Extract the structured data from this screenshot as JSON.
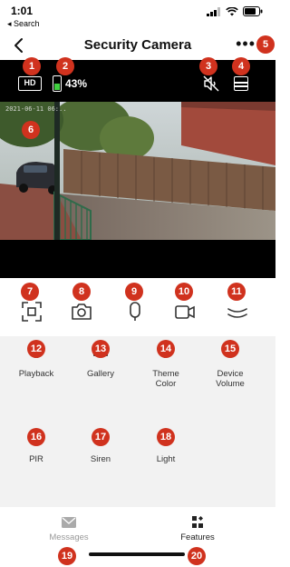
{
  "status_bar": {
    "time": "1:01",
    "back_label": "◂ Search",
    "icons": [
      "signal-icon",
      "wifi-icon",
      "battery-icon"
    ]
  },
  "nav": {
    "title": "Security Camera",
    "back_icon": "chevron-left-icon",
    "more_icon": "more-horizontal-icon",
    "more_glyph": "•••"
  },
  "video": {
    "quality": "HD",
    "battery_percent": "43%",
    "battery_level": 0.43,
    "timestamp": "2021-06-11 06:..",
    "mute_icon": "speaker-muted-icon",
    "layout_icon": "layout-icon"
  },
  "controls": [
    {
      "name": "fullscreen",
      "icon": "fullscreen-icon"
    },
    {
      "name": "snapshot",
      "icon": "camera-icon"
    },
    {
      "name": "talk",
      "icon": "microphone-icon"
    },
    {
      "name": "record",
      "icon": "video-record-icon"
    },
    {
      "name": "collapse",
      "icon": "chevron-double-down-icon"
    }
  ],
  "features": [
    {
      "label": "Playback",
      "icon": "play-circle-icon"
    },
    {
      "label": "Gallery",
      "icon": "image-icon"
    },
    {
      "label": "Theme\nColor",
      "icon": "palette-icon"
    },
    {
      "label": "Device\nVolume",
      "icon": "volume-icon"
    },
    {
      "label": "PIR",
      "icon": "pir-sensor-icon"
    },
    {
      "label": "Siren",
      "icon": "siren-icon"
    },
    {
      "label": "Light",
      "icon": "light-icon"
    }
  ],
  "tabs": [
    {
      "label": "Messages",
      "icon": "mail-icon",
      "active": false
    },
    {
      "label": "Features",
      "icon": "grid-icon",
      "active": true
    }
  ],
  "badges": [
    "1",
    "2",
    "3",
    "4",
    "5",
    "6",
    "7",
    "8",
    "9",
    "10",
    "11",
    "12",
    "13",
    "14",
    "15",
    "16",
    "17",
    "18",
    "19",
    "20"
  ],
  "colors": {
    "badge": "#d0321e",
    "battery_fill": "#40d040",
    "features_bg": "#f2f2f2",
    "inactive_tab": "#999999",
    "active_tab": "#222222"
  }
}
